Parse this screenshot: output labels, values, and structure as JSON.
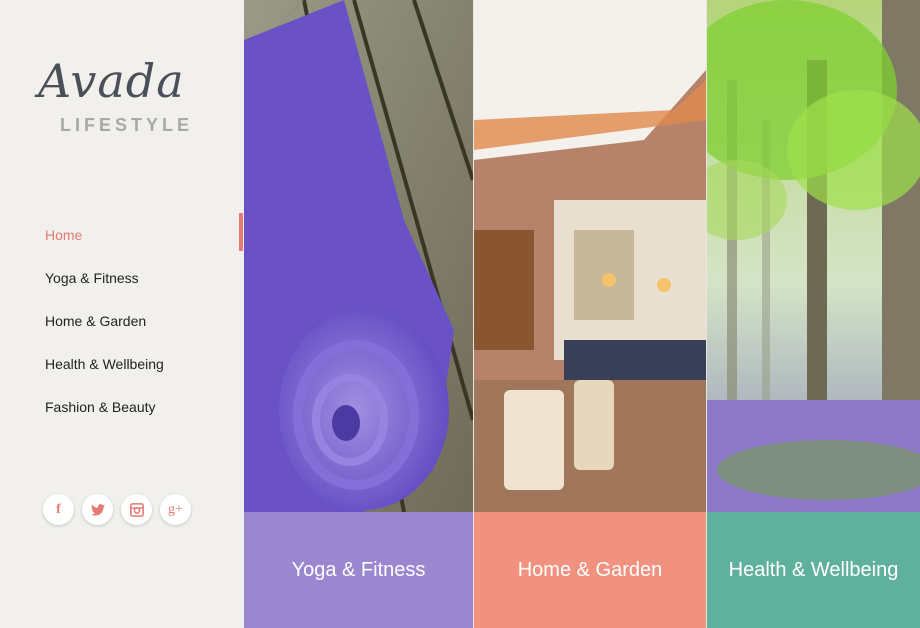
{
  "brand": {
    "script": "Avada",
    "sub": "LIFESTYLE"
  },
  "nav": [
    {
      "label": "Home",
      "active": true
    },
    {
      "label": "Yoga & Fitness"
    },
    {
      "label": "Home & Garden"
    },
    {
      "label": "Health & Wellbeing"
    },
    {
      "label": "Fashion & Beauty"
    }
  ],
  "social": [
    {
      "icon": "facebook-icon",
      "glyph": "f"
    },
    {
      "icon": "twitter-icon",
      "glyph": "🐦"
    },
    {
      "icon": "instagram-icon",
      "glyph": "◙"
    },
    {
      "icon": "google-plus-icon",
      "glyph": "g+"
    }
  ],
  "panels": [
    {
      "caption": "Yoga & Fitness",
      "color": "#9a87cf",
      "image": "yoga-mat-photo"
    },
    {
      "caption": "Home & Garden",
      "color": "#f0927f",
      "image": "kitchen-interior-photo"
    },
    {
      "caption": "Health & Wellbeing",
      "color": "#5fb09c",
      "image": "forest-photo"
    }
  ],
  "colors": {
    "accent": "#e47a73",
    "sidebar_bg": "#f1f0ec"
  }
}
